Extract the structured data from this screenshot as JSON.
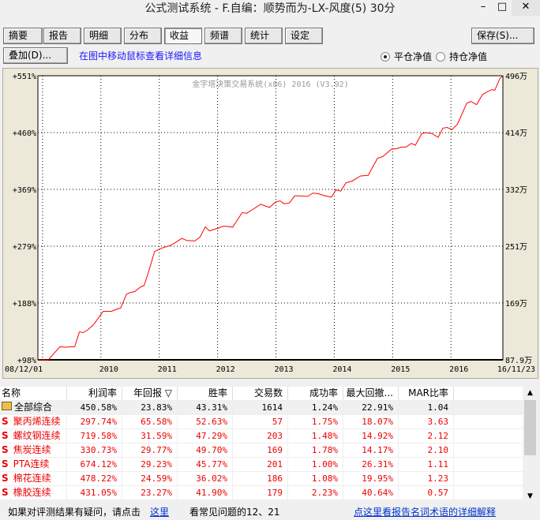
{
  "window": {
    "title": "公式测试系统 - F.自编：顺势而为-LX-风度(5) 30分",
    "minimize": "–",
    "maximize": "□",
    "close": "✕"
  },
  "tabs": [
    {
      "label": "摘要"
    },
    {
      "label": "报告"
    },
    {
      "label": "明细"
    },
    {
      "label": "分布"
    },
    {
      "label": "收益",
      "active": true
    },
    {
      "label": "频谱"
    },
    {
      "label": "统计"
    },
    {
      "label": "设定"
    }
  ],
  "toolbar": {
    "save": "保存(S)...",
    "overlay": "叠加(D)...",
    "hint": "在图中移动鼠标查看详细信息",
    "radio1": "平仓净值",
    "radio2": "持仓净值",
    "radio_selected": "平仓净值"
  },
  "chart_data": {
    "type": "line",
    "watermark": "金字塔决策交易系统(x86) 2016 (V3.92)",
    "x_start_label": "08/12/01",
    "x_end_label": "16/11/23",
    "xlim": [
      2008.92,
      2016.89
    ],
    "year_ticks": [
      2009,
      2010,
      2011,
      2012,
      2013,
      2014,
      2015,
      2016
    ],
    "year_labels": [
      "2010",
      "2011",
      "2012",
      "2013",
      "2014",
      "2015",
      "2016"
    ],
    "ylim": [
      98,
      551
    ],
    "left_ticks": [
      "+98%",
      "+188%",
      "+279%",
      "+369%",
      "+460%",
      "+551%"
    ],
    "right_ticks": [
      "87.9万",
      "169万",
      "251万",
      "332万",
      "414万",
      "496万"
    ],
    "line_color": "#ff0000",
    "series": [
      [
        2008.92,
        98
      ],
      [
        2009.1,
        98
      ],
      [
        2009.21,
        109.7
      ],
      [
        2009.3,
        118.9
      ],
      [
        2009.38,
        118.1
      ],
      [
        2009.55,
        118.9
      ],
      [
        2009.63,
        142.3
      ],
      [
        2009.7,
        141.5
      ],
      [
        2009.77,
        145.3
      ],
      [
        2009.87,
        153.6
      ],
      [
        2010.04,
        175.4
      ],
      [
        2010.18,
        175.4
      ],
      [
        2010.27,
        178.7
      ],
      [
        2010.34,
        180.8
      ],
      [
        2010.44,
        203
      ],
      [
        2010.5,
        205.1
      ],
      [
        2010.58,
        206.8
      ],
      [
        2010.68,
        214.3
      ],
      [
        2010.74,
        216.4
      ],
      [
        2010.8,
        233.1
      ],
      [
        2010.86,
        251.9
      ],
      [
        2010.92,
        270.8
      ],
      [
        2011.01,
        274.9
      ],
      [
        2011.1,
        277.9
      ],
      [
        2011.18,
        280
      ],
      [
        2011.27,
        284.6
      ],
      [
        2011.39,
        291.7
      ],
      [
        2011.47,
        288.3
      ],
      [
        2011.61,
        287.5
      ],
      [
        2011.7,
        293.8
      ],
      [
        2011.79,
        310.1
      ],
      [
        2011.86,
        303.8
      ],
      [
        2012.01,
        308
      ],
      [
        2012.1,
        311.3
      ],
      [
        2012.17,
        310.5
      ],
      [
        2012.26,
        309.7
      ],
      [
        2012.42,
        332.7
      ],
      [
        2012.5,
        331.8
      ],
      [
        2012.6,
        337.7
      ],
      [
        2012.74,
        346.1
      ],
      [
        2012.8,
        344
      ],
      [
        2012.89,
        341
      ],
      [
        2012.99,
        349.4
      ],
      [
        2013.07,
        351.5
      ],
      [
        2013.14,
        346.9
      ],
      [
        2013.23,
        348.1
      ],
      [
        2013.32,
        359.4
      ],
      [
        2013.42,
        359.4
      ],
      [
        2013.54,
        358.6
      ],
      [
        2013.64,
        364
      ],
      [
        2013.73,
        362.8
      ],
      [
        2013.83,
        359.8
      ],
      [
        2013.95,
        357.3
      ],
      [
        2014.03,
        369.1
      ],
      [
        2014.11,
        367
      ],
      [
        2014.2,
        380.3
      ],
      [
        2014.3,
        382.9
      ],
      [
        2014.45,
        391.2
      ],
      [
        2014.58,
        392.1
      ],
      [
        2014.74,
        419.2
      ],
      [
        2014.83,
        422.2
      ],
      [
        2014.98,
        433.9
      ],
      [
        2015.07,
        434.7
      ],
      [
        2015.15,
        437.2
      ],
      [
        2015.23,
        437.2
      ],
      [
        2015.32,
        443.1
      ],
      [
        2015.39,
        440.2
      ],
      [
        2015.5,
        459
      ],
      [
        2015.57,
        460.2
      ],
      [
        2015.67,
        459
      ],
      [
        2015.78,
        452.7
      ],
      [
        2015.86,
        467.4
      ],
      [
        2015.93,
        468.6
      ],
      [
        2016.02,
        465.3
      ],
      [
        2016.11,
        473.6
      ],
      [
        2016.27,
        507.1
      ],
      [
        2016.34,
        510
      ],
      [
        2016.44,
        505
      ],
      [
        2016.54,
        520.9
      ],
      [
        2016.63,
        525.9
      ],
      [
        2016.7,
        528.8
      ],
      [
        2016.75,
        528
      ],
      [
        2016.84,
        546.8
      ],
      [
        2016.89,
        551
      ]
    ]
  },
  "table": {
    "headers": [
      "名称",
      "利润率",
      "年回报 ▽",
      "胜率",
      "交易数",
      "成功率",
      "最大回撤...",
      "MAR比率"
    ],
    "rows": [
      {
        "icon": "folder",
        "name": "全部综合",
        "v": [
          "450.58%",
          "23.83%",
          "43.31%",
          "1614",
          "1.24%",
          "22.91%",
          "1.04"
        ]
      },
      {
        "icon": "S",
        "name": "聚丙烯连续",
        "v": [
          "297.74%",
          "65.58%",
          "52.63%",
          "57",
          "1.75%",
          "18.07%",
          "3.63"
        ]
      },
      {
        "icon": "S",
        "name": "螺纹钢连续",
        "v": [
          "719.58%",
          "31.59%",
          "47.29%",
          "203",
          "1.48%",
          "14.92%",
          "2.12"
        ]
      },
      {
        "icon": "S",
        "name": "焦炭连续",
        "v": [
          "330.73%",
          "29.77%",
          "49.70%",
          "169",
          "1.78%",
          "14.17%",
          "2.10"
        ]
      },
      {
        "icon": "S",
        "name": "PTA连续",
        "v": [
          "674.12%",
          "29.23%",
          "45.77%",
          "201",
          "1.00%",
          "26.31%",
          "1.11"
        ]
      },
      {
        "icon": "S",
        "name": "棉花连续",
        "v": [
          "478.22%",
          "24.59%",
          "36.02%",
          "186",
          "1.08%",
          "19.95%",
          "1.23"
        ]
      },
      {
        "icon": "S",
        "name": "橡胶连续",
        "v": [
          "431.05%",
          "23.27%",
          "41.90%",
          "179",
          "2.23%",
          "40.64%",
          "0.57"
        ]
      }
    ]
  },
  "status": {
    "text1": "如果对评测结果有疑问，请点击",
    "link1": "这里",
    "text2": "看常见问题的12、21",
    "link2": "点这里看报告名词术语的详细解释"
  }
}
